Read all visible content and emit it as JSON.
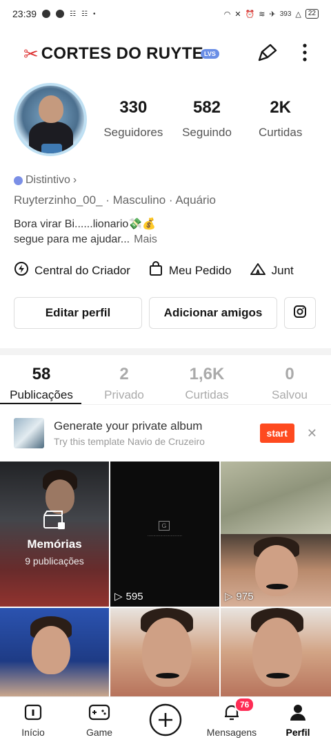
{
  "status_bar": {
    "time": "23:39",
    "battery": "22",
    "signal_text": "393"
  },
  "header": {
    "title": "CORTES DO RUYTE",
    "badge": "LVS"
  },
  "stats": [
    {
      "value": "330",
      "label": "Seguidores"
    },
    {
      "value": "582",
      "label": "Seguindo"
    },
    {
      "value": "2K",
      "label": "Curtidas"
    }
  ],
  "profile": {
    "distintivo": "Distintivo",
    "meta": "Ruyterzinho_00_  · Masculino · Aquário",
    "bio_line1": "Bora virar Bi......lionario💸💰",
    "bio_line2": "segue para me ajudar...",
    "more": "Mais"
  },
  "shortcuts": [
    {
      "label": "Central do Criador",
      "icon": "lightning-icon"
    },
    {
      "label": "Meu Pedido",
      "icon": "shopping-bag-icon"
    },
    {
      "label": "Junt",
      "icon": "tent-icon"
    }
  ],
  "buttons": {
    "edit": "Editar perfil",
    "add_friends": "Adicionar amigos"
  },
  "tabs": [
    {
      "value": "58",
      "label": "Publicações"
    },
    {
      "value": "2",
      "label": "Privado"
    },
    {
      "value": "1,6K",
      "label": "Curtidas"
    },
    {
      "value": "0",
      "label": "Salvou"
    }
  ],
  "banner": {
    "title": "Generate your private album",
    "subtitle": "Try this template Navio de Cruzeiro",
    "action": "start"
  },
  "grid": {
    "memories_title": "Memórias",
    "memories_sub": "9 publicações",
    "video2_views": "595",
    "video4_views": "975"
  },
  "nav": [
    {
      "label": "Início"
    },
    {
      "label": "Game"
    },
    {
      "label": ""
    },
    {
      "label": "Mensagens",
      "badge": "76"
    },
    {
      "label": "Perfil"
    }
  ],
  "colors": {
    "accent": "#fe4a1f",
    "notification": "#fe2c55",
    "badge_blue": "#6a8ee6"
  }
}
